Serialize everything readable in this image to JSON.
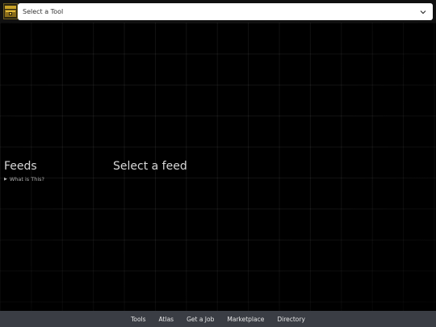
{
  "header": {
    "logo_icon": "treasure-chest-logo-icon",
    "tool_select": {
      "placeholder": "Select a Tool",
      "chevron_icon": "chevron-down-icon"
    }
  },
  "main": {
    "feeds_title": "Feeds",
    "what_is_this": "What is This?",
    "disclosure_icon": "disclosure-triangle-icon",
    "select_feed": "Select a feed"
  },
  "footer": {
    "links": [
      "Tools",
      "Atlas",
      "Get a Job",
      "Marketplace",
      "Directory"
    ]
  },
  "colors": {
    "background": "#000000",
    "footer_bg": "#3a3d44",
    "logo_gold": "#c9a227"
  }
}
